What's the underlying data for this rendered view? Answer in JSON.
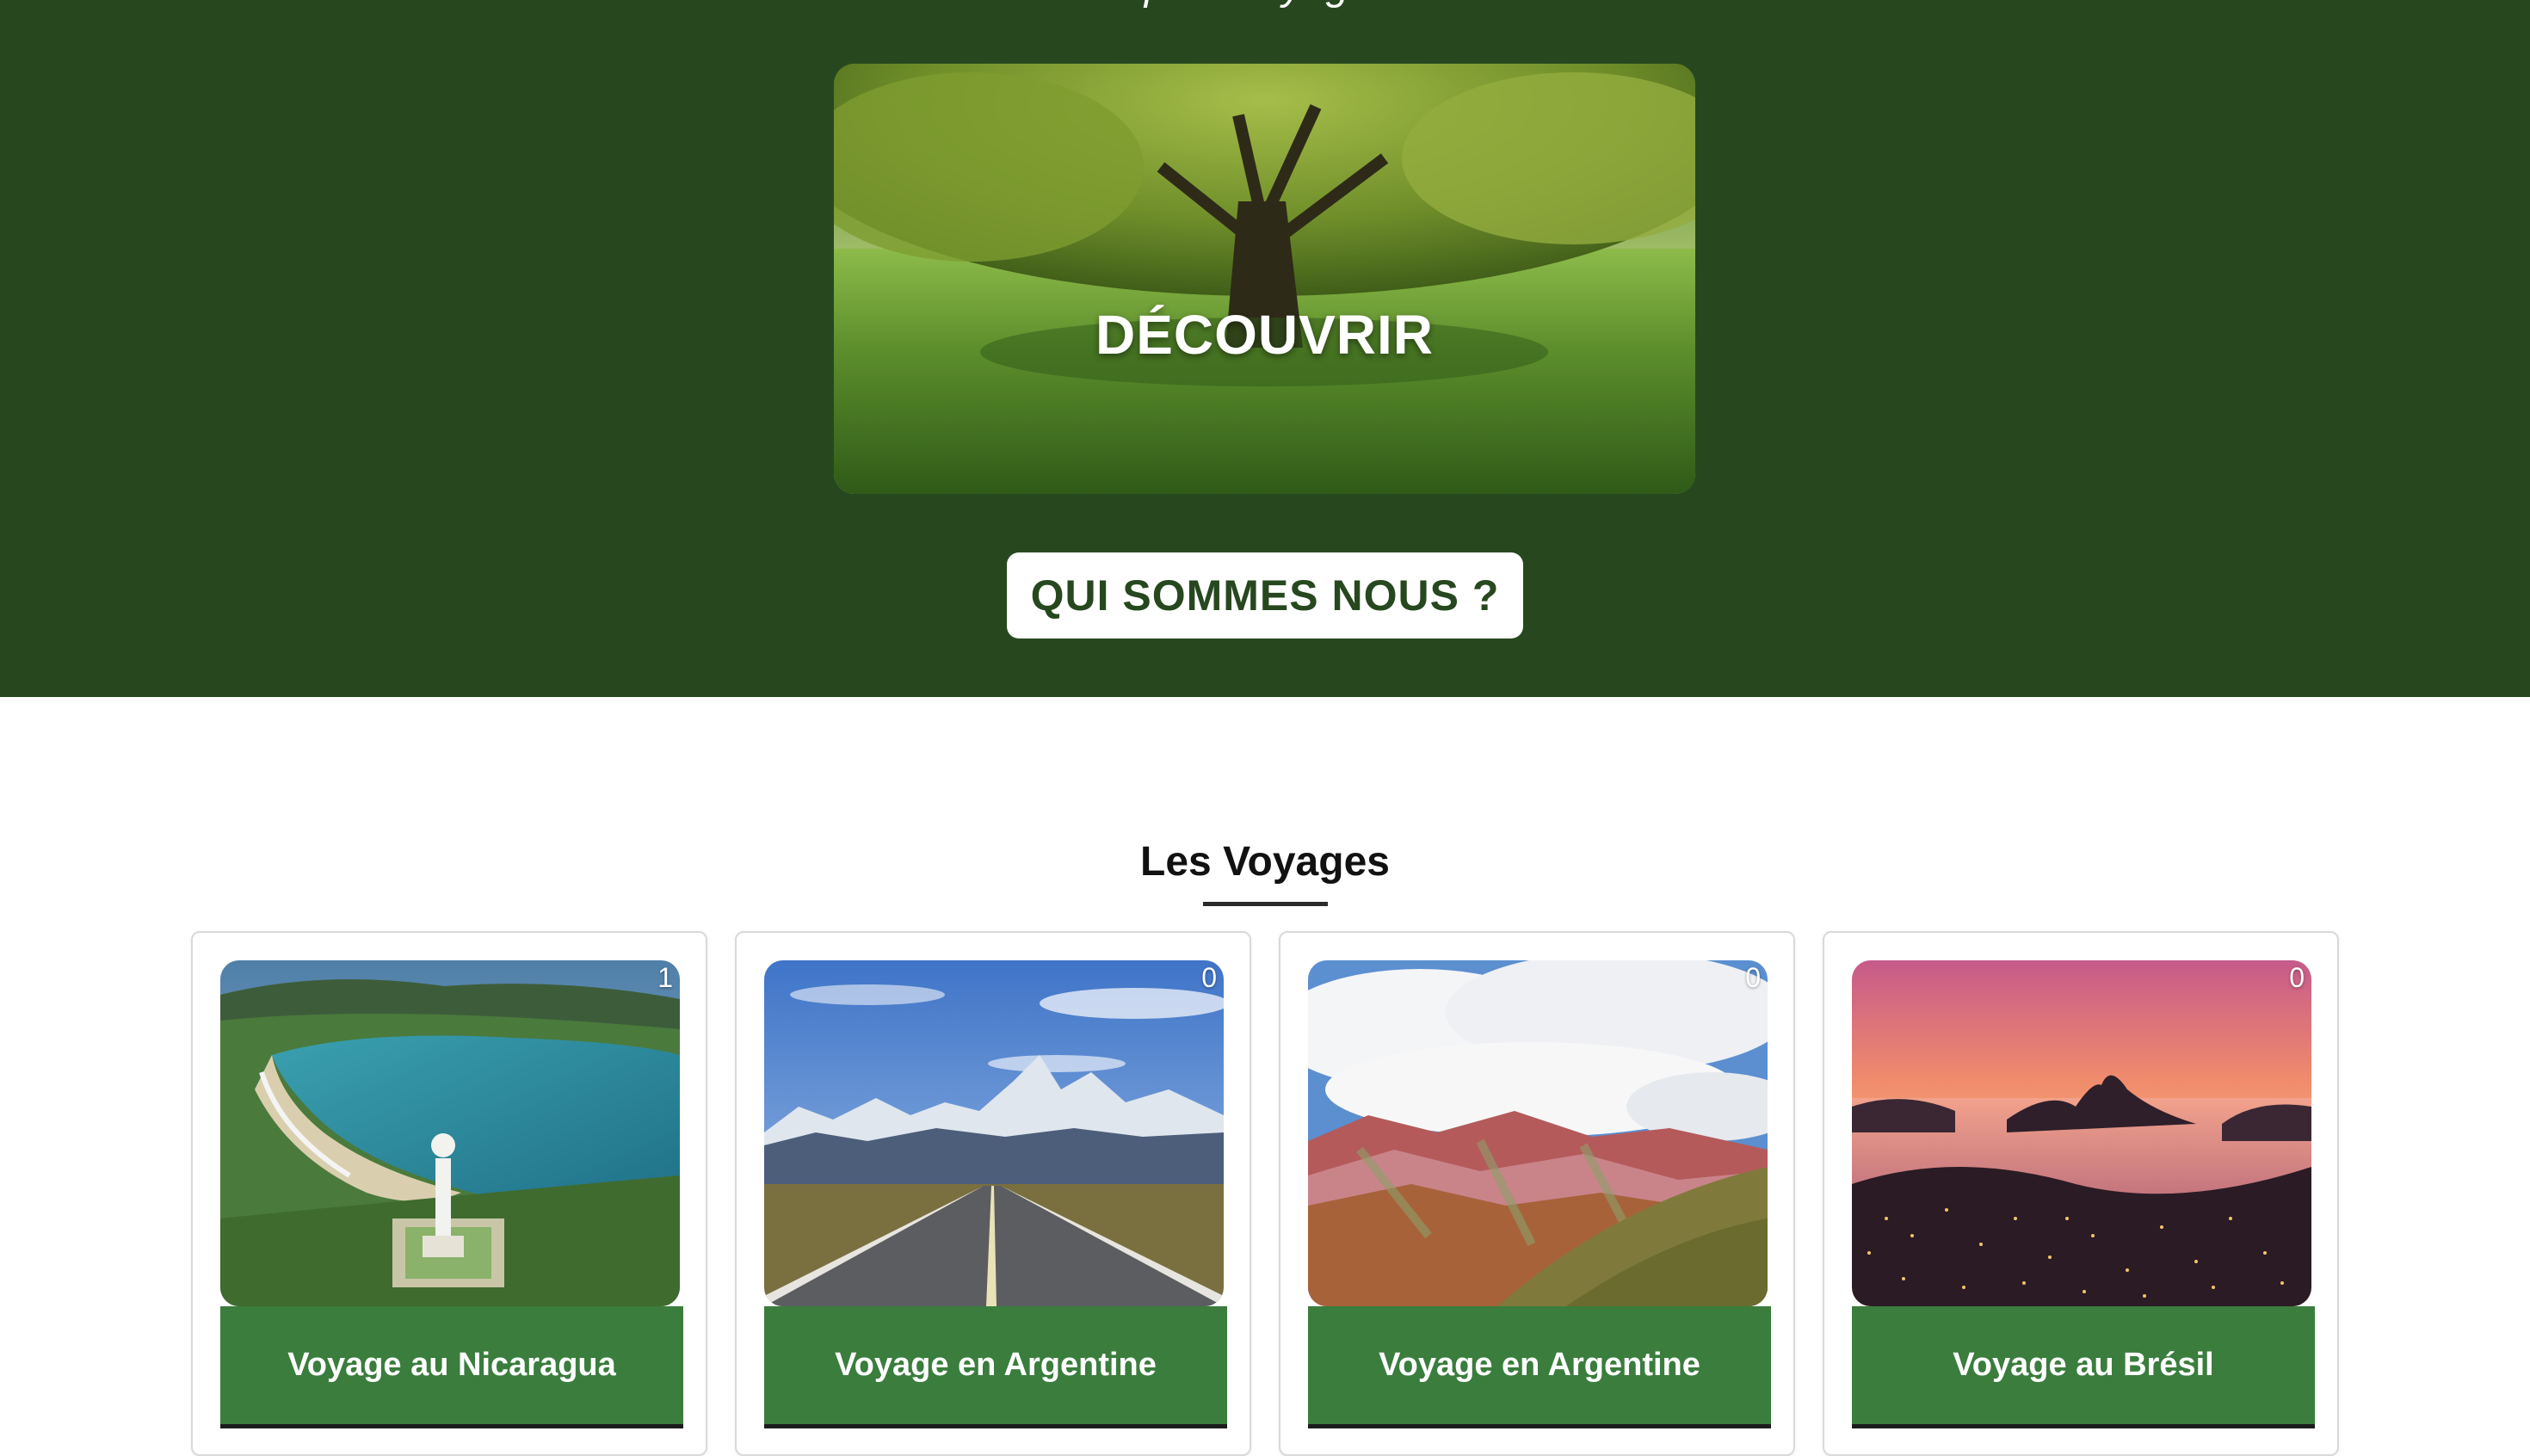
{
  "hero": {
    "subtitle": "… pour voyager …",
    "discover_label": "DÉCOUVRIR",
    "about_button": "QUI SOMMES NOUS ?",
    "background_color": "#27481f"
  },
  "voyages": {
    "title": "Les Voyages",
    "cards": [
      {
        "title": "Voyage au Nicaragua",
        "count": "1",
        "image": "nicaragua-bay-statue"
      },
      {
        "title": "Voyage en Argentine",
        "count": "0",
        "image": "patagonia-road-mountains"
      },
      {
        "title": "Voyage en Argentine",
        "count": "0",
        "image": "rainbow-mountains"
      },
      {
        "title": "Voyage au Brésil",
        "count": "0",
        "image": "rio-sunset"
      }
    ],
    "button_color": "#3a7d3d"
  }
}
